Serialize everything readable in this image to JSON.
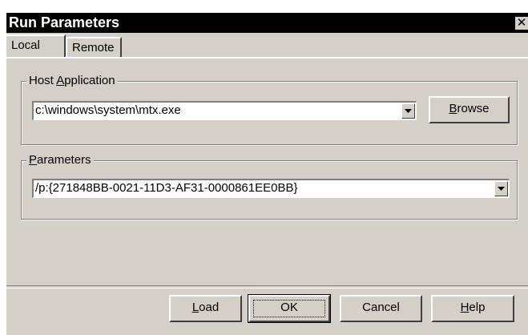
{
  "window": {
    "title": "Run Parameters",
    "close_glyph": "✕"
  },
  "tabs": [
    {
      "label": "Local",
      "selected": true
    },
    {
      "label": "Remote",
      "selected": false
    }
  ],
  "host_application": {
    "legend_prefix": "Host ",
    "legend_accel": "A",
    "legend_suffix": "pplication",
    "value": "c:\\windows\\system\\mtx.exe"
  },
  "parameters": {
    "legend_prefix": "",
    "legend_accel": "P",
    "legend_suffix": "arameters",
    "value": "/p:{271848BB-0021-11D3-AF31-0000861EE0BB}"
  },
  "buttons": {
    "browse": {
      "accel": "B",
      "rest": "rowse"
    },
    "load": {
      "accel": "L",
      "rest": "oad"
    },
    "ok": {
      "label": "OK"
    },
    "cancel": {
      "label": "Cancel"
    },
    "help": {
      "accel": "H",
      "rest": "elp"
    }
  },
  "icons": {
    "close": "close-icon",
    "dropdown": "chevron-down-icon"
  }
}
